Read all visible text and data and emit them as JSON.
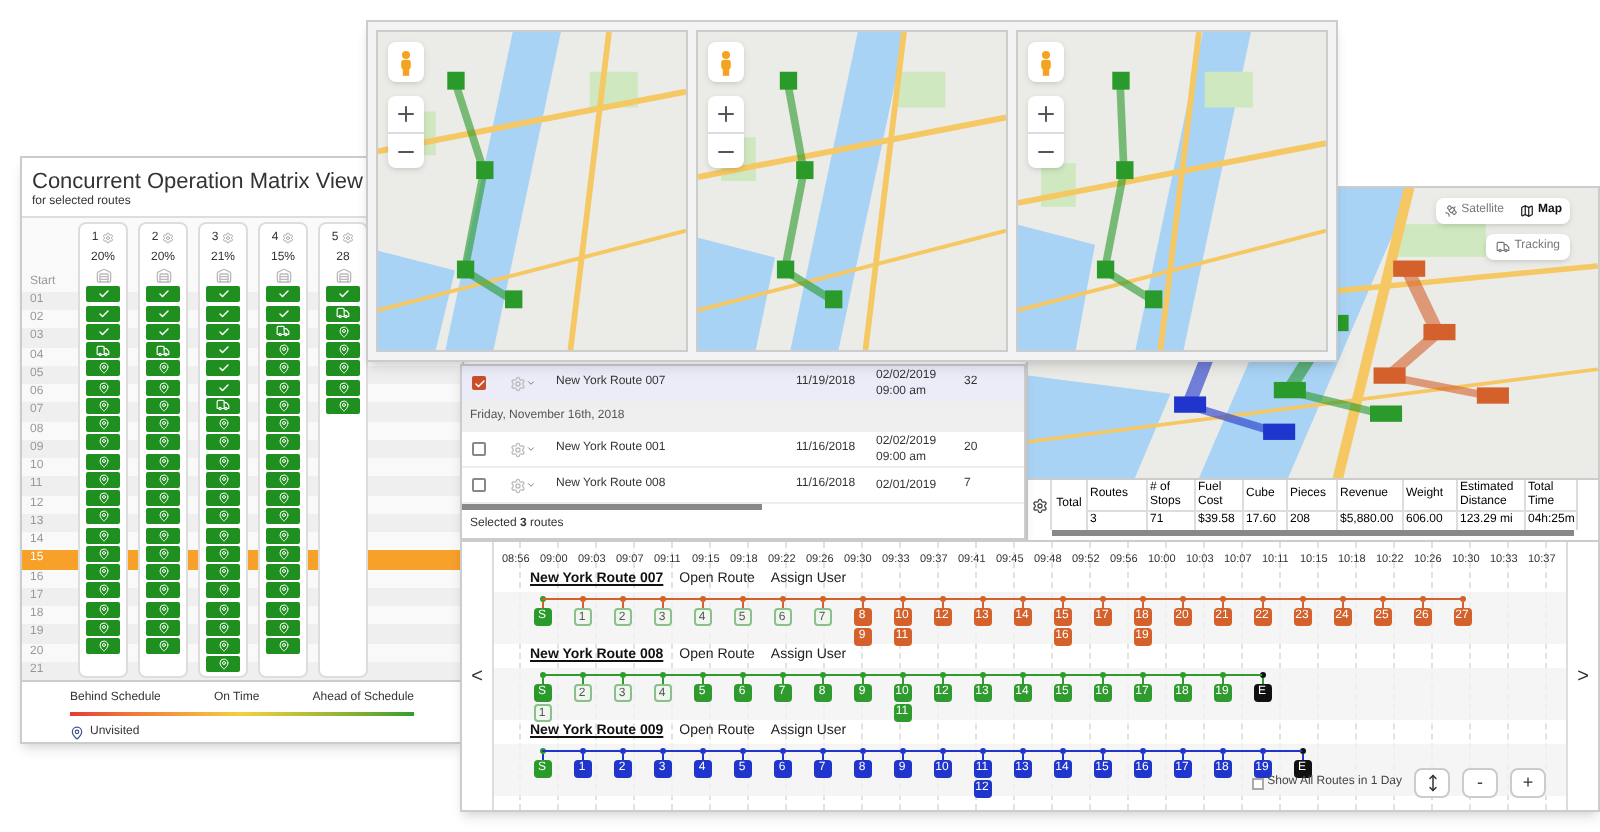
{
  "matrix": {
    "title": "Concurrent Operation Matrix View",
    "subtitle": "for selected routes",
    "rows": [
      {
        "label": "Start",
        "selected": false
      },
      {
        "label": "01",
        "selected": false
      },
      {
        "label": "02",
        "selected": false
      },
      {
        "label": "03",
        "selected": false
      },
      {
        "label": "04",
        "selected": false
      },
      {
        "label": "05",
        "selected": false
      },
      {
        "label": "06",
        "selected": false
      },
      {
        "label": "07",
        "selected": false
      },
      {
        "label": "08",
        "selected": false
      },
      {
        "label": "09",
        "selected": false
      },
      {
        "label": "10",
        "selected": false
      },
      {
        "label": "11",
        "selected": false
      },
      {
        "label": "12",
        "selected": false
      },
      {
        "label": "13",
        "selected": false
      },
      {
        "label": "14",
        "selected": false
      },
      {
        "label": "15",
        "selected": true
      },
      {
        "label": "16",
        "selected": false
      },
      {
        "label": "17",
        "selected": false
      },
      {
        "label": "18",
        "selected": false
      },
      {
        "label": "19",
        "selected": false
      },
      {
        "label": "20",
        "selected": false
      },
      {
        "label": "21",
        "selected": false
      }
    ],
    "columns": [
      {
        "number": "1",
        "percent": "20%",
        "cells": [
          {
            "kind": "done"
          },
          {
            "kind": "done"
          },
          {
            "kind": "done"
          },
          {
            "kind": "truck"
          },
          {
            "kind": "pending"
          },
          {
            "kind": "pending"
          },
          {
            "kind": "pending"
          },
          {
            "kind": "pending"
          },
          {
            "kind": "pending"
          },
          {
            "kind": "pending"
          },
          {
            "kind": "pending"
          },
          {
            "kind": "pending"
          },
          {
            "kind": "pending"
          },
          {
            "kind": "pending"
          },
          {
            "kind": "pending"
          },
          {
            "kind": "pending"
          },
          {
            "kind": "pending"
          },
          {
            "kind": "pending"
          },
          {
            "kind": "pending"
          },
          {
            "kind": "pending"
          }
        ]
      },
      {
        "number": "2",
        "percent": "20%",
        "cells": [
          {
            "kind": "done"
          },
          {
            "kind": "done"
          },
          {
            "kind": "done"
          },
          {
            "kind": "truck"
          },
          {
            "kind": "pending"
          },
          {
            "kind": "pending"
          },
          {
            "kind": "pending"
          },
          {
            "kind": "pending"
          },
          {
            "kind": "pending"
          },
          {
            "kind": "pending"
          },
          {
            "kind": "pending"
          },
          {
            "kind": "pending"
          },
          {
            "kind": "pending"
          },
          {
            "kind": "pending"
          },
          {
            "kind": "pending"
          },
          {
            "kind": "pending"
          },
          {
            "kind": "pending"
          },
          {
            "kind": "pending"
          },
          {
            "kind": "pending"
          },
          {
            "kind": "pending"
          }
        ]
      },
      {
        "number": "3",
        "percent": "21%",
        "cells": [
          {
            "kind": "done"
          },
          {
            "kind": "done"
          },
          {
            "kind": "done"
          },
          {
            "kind": "done"
          },
          {
            "kind": "done"
          },
          {
            "kind": "done"
          },
          {
            "kind": "truck"
          },
          {
            "kind": "pending"
          },
          {
            "kind": "pending"
          },
          {
            "kind": "pending"
          },
          {
            "kind": "pending"
          },
          {
            "kind": "pending"
          },
          {
            "kind": "pending"
          },
          {
            "kind": "pending"
          },
          {
            "kind": "pending"
          },
          {
            "kind": "pending"
          },
          {
            "kind": "pending"
          },
          {
            "kind": "pending"
          },
          {
            "kind": "pending"
          },
          {
            "kind": "pending"
          },
          {
            "kind": "pending"
          }
        ]
      },
      {
        "number": "4",
        "percent": "15%",
        "cells": [
          {
            "kind": "done"
          },
          {
            "kind": "done"
          },
          {
            "kind": "truck"
          },
          {
            "kind": "pending"
          },
          {
            "kind": "pending"
          },
          {
            "kind": "pending"
          },
          {
            "kind": "pending"
          },
          {
            "kind": "pending"
          },
          {
            "kind": "pending"
          },
          {
            "kind": "pending"
          },
          {
            "kind": "pending"
          },
          {
            "kind": "pending"
          },
          {
            "kind": "pending"
          },
          {
            "kind": "pending"
          },
          {
            "kind": "pending"
          },
          {
            "kind": "pending"
          },
          {
            "kind": "pending"
          },
          {
            "kind": "pending"
          },
          {
            "kind": "pending"
          },
          {
            "kind": "pending"
          }
        ]
      },
      {
        "number": "5",
        "percent": "28",
        "cells": [
          {
            "kind": "done"
          },
          {
            "kind": "truck"
          },
          {
            "kind": "pending"
          },
          {
            "kind": "pending"
          },
          {
            "kind": "pending"
          },
          {
            "kind": "pending"
          },
          {
            "kind": "pending"
          }
        ]
      }
    ],
    "legend": {
      "behind": "Behind Schedule",
      "on_time": "On Time",
      "ahead": "Ahead of Schedule",
      "unvisited": "Unvisited"
    }
  },
  "route_map": {
    "view_toggle": [
      {
        "label": "Satellite",
        "selected": false
      },
      {
        "label": "Map",
        "selected": true
      }
    ],
    "tracking": "Tracking",
    "totals": {
      "label": "Total",
      "columns": [
        "Routes",
        "# of Stops",
        "Fuel Cost",
        "Cube",
        "Pieces",
        "Revenue",
        "Weight",
        "Estimated Distance",
        "Total Time"
      ],
      "values": [
        "3",
        "71",
        "$39.58",
        "17.60",
        "208",
        "$5,880.00",
        "606.00",
        "123.29 mi",
        "04h:25m"
      ]
    }
  },
  "route_list": {
    "rows": [
      {
        "kind": "route",
        "checked": true,
        "selected": true,
        "name": "New York Route 007",
        "date": "11/19/2018",
        "due": "02/02/2019",
        "due_time": "09:00 am",
        "stops": "32"
      },
      {
        "kind": "group",
        "label": "Friday, November 16th, 2018"
      },
      {
        "kind": "route",
        "checked": false,
        "selected": false,
        "name": "New York Route 001",
        "date": "11/16/2018",
        "due": "02/02/2019",
        "due_time": "09:00 am",
        "stops": "20"
      },
      {
        "kind": "route",
        "checked": false,
        "selected": false,
        "name": "New York Route 008",
        "date": "11/16/2018",
        "due": "02/01/2019",
        "stops": "7"
      }
    ],
    "footer": "Selected **3** routes"
  },
  "timeline": {
    "prev": "<",
    "next": ">",
    "times": [
      "08:56",
      "09:00",
      "09:03",
      "09:07",
      "09:11",
      "09:15",
      "09:18",
      "09:22",
      "09:26",
      "09:30",
      "09:33",
      "09:37",
      "09:41",
      "09:45",
      "09:48",
      "09:52",
      "09:56",
      "10:00",
      "10:03",
      "10:07",
      "10:11",
      "10:15",
      "10:18",
      "10:22",
      "10:26",
      "10:30",
      "10:33",
      "10:37"
    ],
    "routes": [
      {
        "name": "New York Route 007",
        "open": "Open Route",
        "assign": "Assign User",
        "color": "#d4612c",
        "stops": [
          {
            "label": "S",
            "kind": "start"
          },
          {
            "label": "1",
            "kind": "done"
          },
          {
            "label": "2",
            "kind": "done"
          },
          {
            "label": "3",
            "kind": "done"
          },
          {
            "label": "4",
            "kind": "done"
          },
          {
            "label": "5",
            "kind": "done"
          },
          {
            "label": "6",
            "kind": "done"
          },
          {
            "label": "7",
            "kind": "done"
          },
          {
            "label": "8",
            "kind": "stop",
            "under": {
              "label": "9",
              "kind": "stop"
            }
          },
          {
            "label": "10",
            "kind": "stop",
            "under": {
              "label": "11",
              "kind": "stop"
            }
          },
          {
            "label": "12",
            "kind": "stop"
          },
          {
            "label": "13",
            "kind": "stop"
          },
          {
            "label": "14",
            "kind": "stop"
          },
          {
            "label": "15",
            "kind": "stop",
            "under": {
              "label": "16",
              "kind": "stop"
            }
          },
          {
            "label": "17",
            "kind": "stop"
          },
          {
            "label": "18",
            "kind": "stop",
            "under": {
              "label": "19",
              "kind": "stop"
            }
          },
          {
            "label": "20",
            "kind": "stop"
          },
          {
            "label": "21",
            "kind": "stop"
          },
          {
            "label": "22",
            "kind": "stop"
          },
          {
            "label": "23",
            "kind": "stop"
          },
          {
            "label": "24",
            "kind": "stop"
          },
          {
            "label": "25",
            "kind": "stop"
          },
          {
            "label": "26",
            "kind": "stop"
          },
          {
            "label": "27",
            "kind": "stop"
          }
        ]
      },
      {
        "name": "New York Route 008",
        "open": "Open Route",
        "assign": "Assign User",
        "color": "#2f9b2f",
        "stops": [
          {
            "label": "S",
            "kind": "start",
            "under": {
              "label": "1",
              "kind": "done"
            }
          },
          {
            "label": "2",
            "kind": "done"
          },
          {
            "label": "3",
            "kind": "done"
          },
          {
            "label": "4",
            "kind": "done"
          },
          {
            "label": "5",
            "kind": "stop"
          },
          {
            "label": "6",
            "kind": "stop"
          },
          {
            "label": "7",
            "kind": "stop"
          },
          {
            "label": "8",
            "kind": "stop"
          },
          {
            "label": "9",
            "kind": "stop"
          },
          {
            "label": "10",
            "kind": "stop",
            "under": {
              "label": "11",
              "kind": "stop"
            }
          },
          {
            "label": "12",
            "kind": "stop"
          },
          {
            "label": "13",
            "kind": "stop"
          },
          {
            "label": "14",
            "kind": "stop"
          },
          {
            "label": "15",
            "kind": "stop"
          },
          {
            "label": "16",
            "kind": "stop"
          },
          {
            "label": "17",
            "kind": "stop"
          },
          {
            "label": "18",
            "kind": "stop"
          },
          {
            "label": "19",
            "kind": "stop"
          },
          {
            "label": "E",
            "kind": "end"
          }
        ]
      },
      {
        "name": "New York Route 009",
        "open": "Open Route",
        "assign": "Assign User",
        "color": "#1f35cc",
        "stops": [
          {
            "label": "S",
            "kind": "start"
          },
          {
            "label": "1",
            "kind": "stop"
          },
          {
            "label": "2",
            "kind": "stop"
          },
          {
            "label": "3",
            "kind": "stop"
          },
          {
            "label": "4",
            "kind": "stop"
          },
          {
            "label": "5",
            "kind": "stop"
          },
          {
            "label": "6",
            "kind": "stop"
          },
          {
            "label": "7",
            "kind": "stop"
          },
          {
            "label": "8",
            "kind": "stop"
          },
          {
            "label": "9",
            "kind": "stop"
          },
          {
            "label": "10",
            "kind": "stop"
          },
          {
            "label": "11",
            "kind": "stop",
            "under": {
              "label": "12",
              "kind": "stop"
            }
          },
          {
            "label": "13",
            "kind": "stop"
          },
          {
            "label": "14",
            "kind": "stop"
          },
          {
            "label": "15",
            "kind": "stop"
          },
          {
            "label": "16",
            "kind": "stop"
          },
          {
            "label": "17",
            "kind": "stop"
          },
          {
            "label": "18",
            "kind": "stop"
          },
          {
            "label": "19",
            "kind": "stop"
          },
          {
            "label": "E",
            "kind": "end"
          }
        ]
      }
    ],
    "show_all": {
      "label": "Show All Routes in 1 Day",
      "checked": false
    },
    "buttons": [
      "-",
      "+"
    ]
  }
}
